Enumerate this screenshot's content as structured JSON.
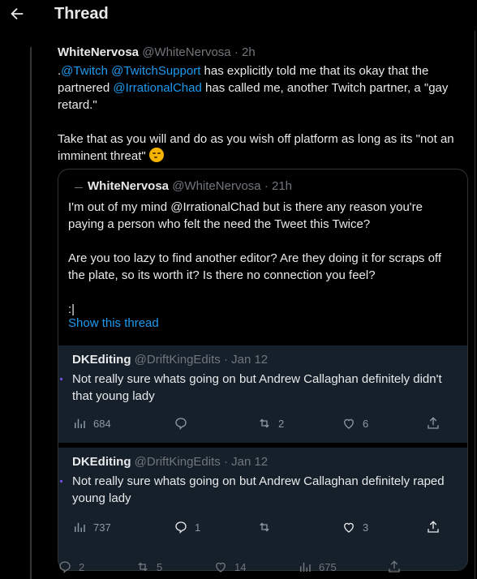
{
  "header": {
    "title": "Thread"
  },
  "tweet": {
    "name": "WhiteNervosa",
    "handle": "@WhiteNervosa",
    "time": "· 2h",
    "lines": [
      [
        ".",
        "@Twitch",
        " ",
        "@TwitchSupport",
        " has explicitly told me that its okay that the"
      ],
      [
        "partnered ",
        "@IrrationalChad",
        " has called me, another Twitch partner, a \"gay"
      ],
      [
        "retard.\""
      ]
    ],
    "para2_line1": "Take that as you will and do as you wish off platform as long as its \"not an",
    "para2_line2": "imminent threat\""
  },
  "quote": {
    "name": "WhiteNervosa",
    "handle": "@WhiteNervosa",
    "time": "· 21h",
    "l1": "I'm out of my mind @IrrationalChad but is there any reason you're",
    "l2": "paying a person who felt the need the Tweet this Twice?",
    "l3": "Are you too lazy to find another editor? Are they doing it for scraps off",
    "l4": "the plate, so its worth it? Is there no connection you feel?",
    "l5": ":|",
    "show_thread": "Show this thread"
  },
  "embed1": {
    "name": "DKEditing",
    "handle": "@DriftKingEdits",
    "time": "· Jan 12",
    "line1": "Not really sure whats going on but Andrew Callaghan definitely didn't",
    "line2": "that young lady",
    "views": "684",
    "replies": "",
    "retweets": "2",
    "likes": "6"
  },
  "embed2": {
    "name": "DKEditing",
    "handle": "@DriftKingEdits",
    "time": "· Jan 12",
    "line1": "Not really sure whats going on but Andrew Callaghan definitely raped",
    "line2": "young lady",
    "views": "737",
    "replies": "1",
    "retweets": "",
    "likes": "3"
  },
  "bottom_actions": {
    "replies": "2",
    "retweets": "5",
    "likes": "14",
    "views": "675"
  },
  "colors": {
    "accent": "#1d9bf0",
    "background": "#000000",
    "card_bg": "#15202b"
  },
  "icons": [
    "back-arrow-icon",
    "views-icon",
    "reply-icon",
    "retweet-icon",
    "like-icon",
    "share-icon"
  ]
}
